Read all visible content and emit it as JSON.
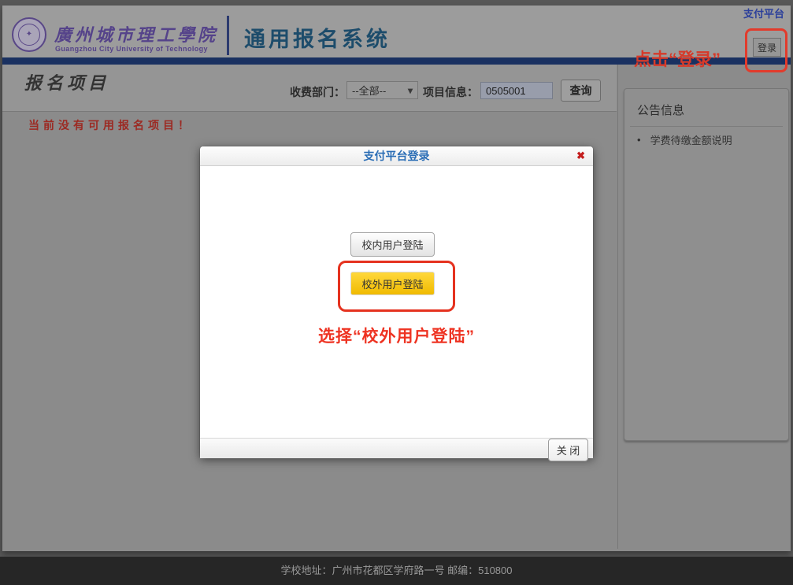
{
  "header": {
    "university_name": "廣州城市理工學院",
    "university_name_en": "Guangzhou City University of Technology",
    "system_title": "通用报名系统",
    "pay_platform_link": "支付平台",
    "login_button": "登录"
  },
  "toolbar": {
    "page_title": "报名项目",
    "department_label": "收费部门：",
    "department_value": "--全部--",
    "project_label": "项目信息：",
    "project_value": "0505001",
    "search_button": "查询"
  },
  "main": {
    "empty_message": "当前没有可用报名项目！"
  },
  "sidebar": {
    "title": "公告信息",
    "items": [
      {
        "label": "学费待缴金额说明"
      }
    ]
  },
  "modal": {
    "title": "支付平台登录",
    "internal_login_button": "校内用户登陆",
    "external_login_button": "校外用户登陆",
    "close_button": "关 闭"
  },
  "annotations": {
    "login_hint": "点击“登录”",
    "choose_hint": "选择“校外用户登陆”"
  },
  "footer": {
    "address": "学校地址：广州市花都区学府路一号 邮编：510800"
  },
  "icons": {
    "close": "✖",
    "chevron_down": "▾",
    "bullet": "•",
    "seal_glyph": "✦"
  },
  "colors": {
    "annotation_red": "#e23b2c",
    "navy_bar": "#1a3161",
    "system_title_blue": "#1d4c6b",
    "brand_purple": "#55438a",
    "modal_title_blue": "#2a6db5",
    "external_button_yellow": "#f0ba00",
    "empty_message_red": "#9c2a23",
    "link_blue": "#2b3f9b"
  }
}
